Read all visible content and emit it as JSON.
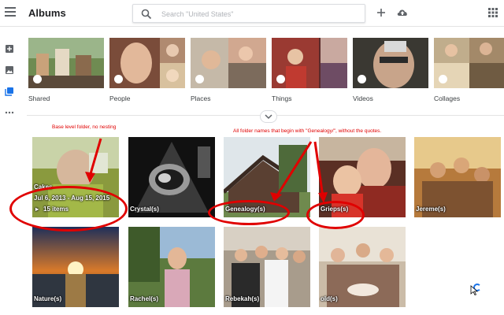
{
  "header": {
    "title": "Albums",
    "search_placeholder": "Search \"United States\""
  },
  "left_rail": [
    {
      "icon": "add-photo-icon"
    },
    {
      "icon": "photos-icon"
    },
    {
      "icon": "albums-icon"
    },
    {
      "icon": "more-icon"
    }
  ],
  "categories": [
    {
      "label": "Shared",
      "icon": "shared-icon"
    },
    {
      "label": "People",
      "icon": "person-icon"
    },
    {
      "label": "Places",
      "icon": "place-icon"
    },
    {
      "label": "Things",
      "icon": "things-icon"
    },
    {
      "label": "Videos",
      "icon": "video-icon"
    },
    {
      "label": "Collages",
      "icon": "collage-icon"
    }
  ],
  "albums": [
    {
      "name": "Cakes",
      "dates": "Jul 6, 2013 - Aug 15, 2015",
      "count": "15 items"
    },
    {
      "name": "Crystal(s)"
    },
    {
      "name": "Genealogy(s)"
    },
    {
      "name": "Grieps(s)"
    },
    {
      "name": "Jereme(s)"
    },
    {
      "name": "Nature(s)"
    },
    {
      "name": "Rachel(s)"
    },
    {
      "name": "Rebekah(s)"
    },
    {
      "name": "old(s)"
    }
  ],
  "annotations": {
    "base_note": "Base level folder, no nesting",
    "genealogy_note": "All folder names that begin with \"Genealogy/\", without the quotes."
  },
  "colors": {
    "accent": "#1a73e8",
    "annotation": "#e00000"
  }
}
